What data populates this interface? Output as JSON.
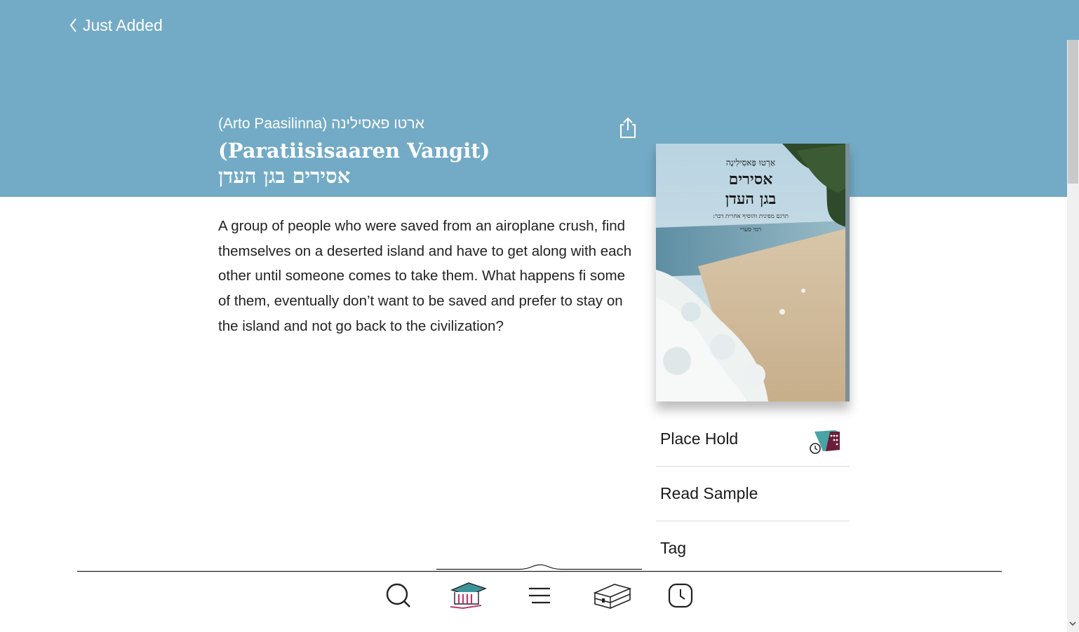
{
  "nav": {
    "back_label": "Just Added"
  },
  "book": {
    "author": "(Arto Paasilinna) ארטו פאסילינה",
    "title": "(Paratiisisaaren Vangit) אסירים בגן העדן",
    "description": "A group of people who were saved from an airoplane crush, find themselves on a deserted island and have to get along with each other until someone comes to take them. What hap­pens fi some of them, eventually don’t want to be saved and prefer to stay on the island and not go back to the civilization?"
  },
  "cover": {
    "author": "אַרְטוּ פַּאסִילִינָה",
    "title_line1": "אסירים",
    "title_line2": "בגן העדן",
    "subtitle_line1": "תרגם מפינית והוסיף אחרית דבר:",
    "subtitle_line2": "רמי סערי"
  },
  "actions": {
    "place_hold": "Place Hold",
    "read_sample": "Read Sample",
    "tag": "Tag"
  },
  "tabs": [
    {
      "name": "search-icon"
    },
    {
      "name": "library-icon"
    },
    {
      "name": "menu-icon"
    },
    {
      "name": "shelf-icon"
    },
    {
      "name": "clock-icon"
    }
  ],
  "colors": {
    "header": "#73abc6",
    "accent_pink": "#c2386b",
    "accent_teal": "#3b9597"
  }
}
